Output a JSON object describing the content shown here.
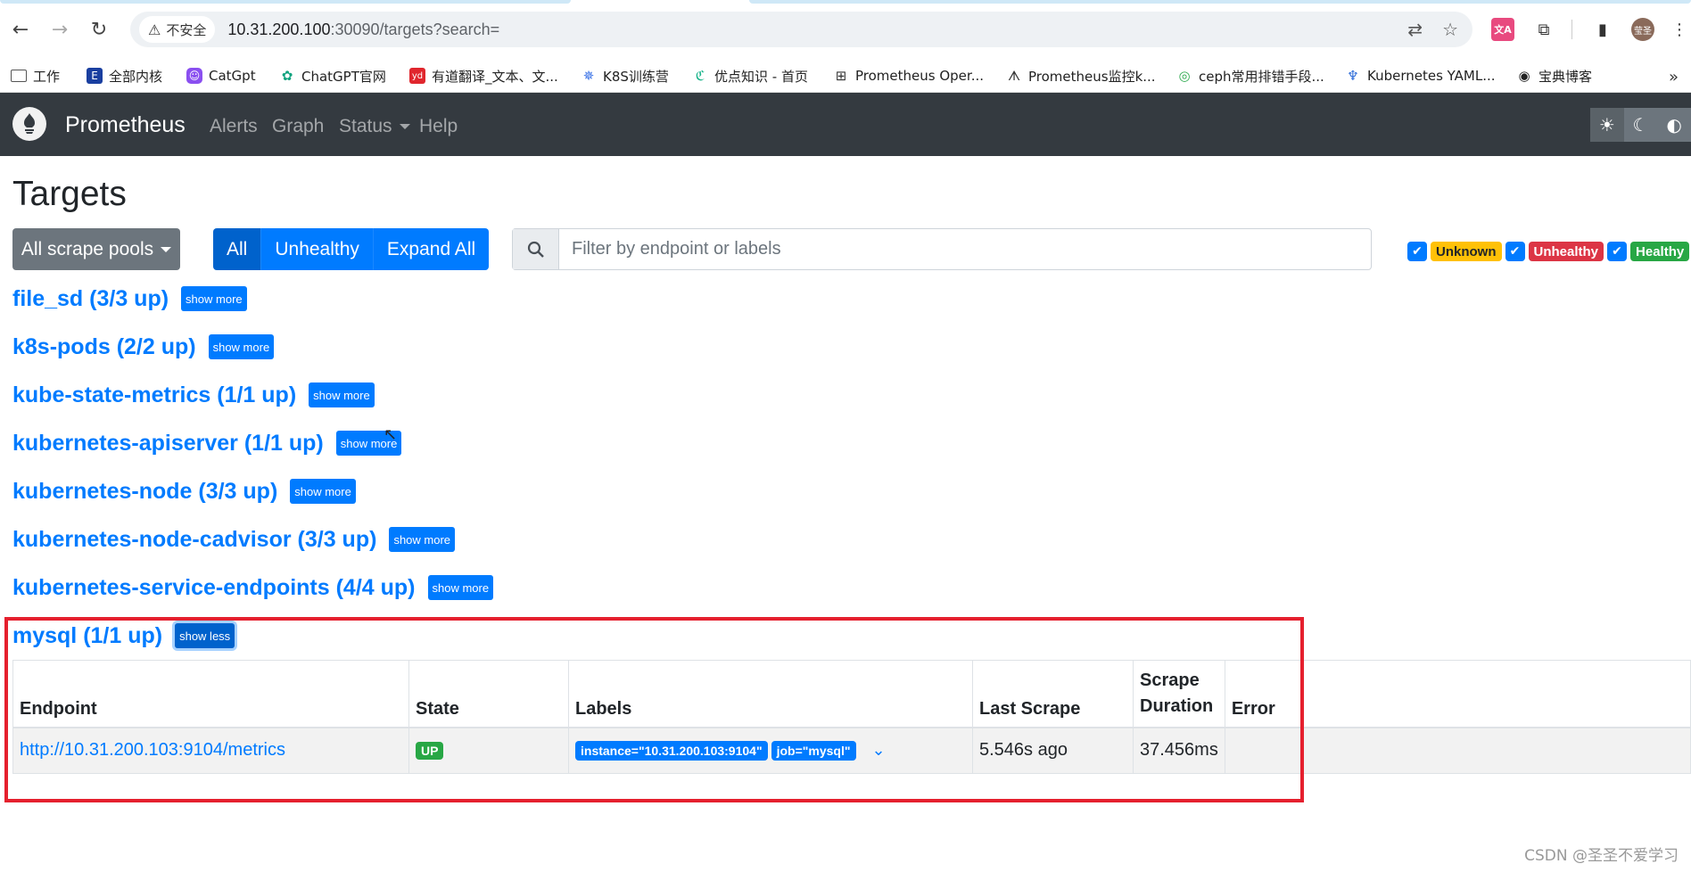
{
  "browser": {
    "security_label": "不安全",
    "url_host": "10.31.200.100",
    "url_rest": ":30090/targets?search=",
    "avatar_text": "莹圣"
  },
  "bookmarks": [
    {
      "label": "工作",
      "icon": "folder-icon"
    },
    {
      "label": "全部内核",
      "icon": "er-icon"
    },
    {
      "label": "CatGpt",
      "icon": "catgpt-icon"
    },
    {
      "label": "ChatGPT官网",
      "icon": "openai-icon"
    },
    {
      "label": "有道翻译_文本、文...",
      "icon": "youdao-icon"
    },
    {
      "label": "K8S训练营",
      "icon": "k8s-icon"
    },
    {
      "label": "优点知识 - 首页",
      "icon": "youdian-icon"
    },
    {
      "label": "Prometheus Oper...",
      "icon": "book-icon"
    },
    {
      "label": "Prometheus监控k...",
      "icon": "prom-icon"
    },
    {
      "label": "ceph常用排错手段...",
      "icon": "ceph-icon"
    },
    {
      "label": "Kubernetes YAML...",
      "icon": "octopus-icon"
    },
    {
      "label": "宝典博客",
      "icon": "globe-icon"
    }
  ],
  "navbar": {
    "brand": "Prometheus",
    "links": [
      "Alerts",
      "Graph",
      "Status",
      "Help"
    ]
  },
  "page": {
    "title": "Targets",
    "pools_button": "All scrape pools",
    "filter_buttons": [
      "All",
      "Unhealthy",
      "Expand All"
    ],
    "search_placeholder": "Filter by endpoint or labels",
    "health_filters": [
      "Unknown",
      "Unhealthy",
      "Healthy"
    ]
  },
  "pools": [
    {
      "name": "file_sd (3/3 up)",
      "button": "show more"
    },
    {
      "name": "k8s-pods (2/2 up)",
      "button": "show more"
    },
    {
      "name": "kube-state-metrics (1/1 up)",
      "button": "show more"
    },
    {
      "name": "kubernetes-apiserver (1/1 up)",
      "button": "show more"
    },
    {
      "name": "kubernetes-node (3/3 up)",
      "button": "show more"
    },
    {
      "name": "kubernetes-node-cadvisor (3/3 up)",
      "button": "show more"
    },
    {
      "name": "kubernetes-service-endpoints (4/4 up)",
      "button": "show more"
    },
    {
      "name": "mysql (1/1 up)",
      "button": "show less"
    }
  ],
  "table": {
    "headers": [
      "Endpoint",
      "State",
      "Labels",
      "Last Scrape",
      "Scrape Duration",
      "Error"
    ],
    "rows": [
      {
        "endpoint": "http://10.31.200.103:9104/metrics",
        "state": "UP",
        "labels": [
          "instance=\"10.31.200.103:9104\"",
          "job=\"mysql\""
        ],
        "last_scrape": "5.546s ago",
        "duration": "37.456ms",
        "error": ""
      }
    ]
  },
  "watermark": "CSDN @圣圣不爱学习"
}
